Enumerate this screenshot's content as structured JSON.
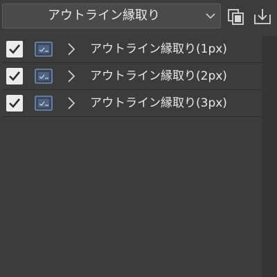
{
  "toolbar": {
    "dropdown_value": "アウトライン縁取り",
    "icons": {
      "dropdown": "chevron-down-icon",
      "copy": "copy-set-icon",
      "import": "import-download-icon"
    }
  },
  "list": {
    "items": [
      {
        "label": "アウトライン縁取り(1px)",
        "checked": true
      },
      {
        "label": "アウトライン縁取り(2px)",
        "checked": true
      },
      {
        "label": "アウトライン縁取り(3px)",
        "checked": true
      }
    ],
    "icons": {
      "checkbox": "checkmark-icon",
      "item": "auto-action-icon",
      "expand": "chevron-right-icon"
    }
  },
  "colors": {
    "background": "#3c3c3c",
    "dropdown_bg": "#4a4a4a",
    "text": "#e8e8e8",
    "checkbox_bg": "#ececec",
    "icon_accent": "#6f8fbf"
  }
}
